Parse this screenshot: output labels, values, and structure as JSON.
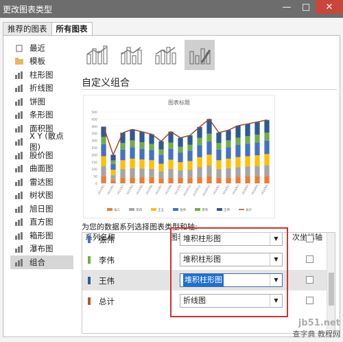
{
  "window": {
    "title": "更改图表类型",
    "minimize": "—",
    "maximize": "□",
    "close": "✕"
  },
  "tabs": [
    "推荐的图表",
    "所有图表"
  ],
  "sidebar": {
    "items": [
      {
        "label": "最近",
        "icon": "recent-icon"
      },
      {
        "label": "模板",
        "icon": "folder-icon"
      },
      {
        "label": "柱形图",
        "icon": "column-chart-icon"
      },
      {
        "label": "折线图",
        "icon": "line-chart-icon"
      },
      {
        "label": "饼图",
        "icon": "pie-chart-icon"
      },
      {
        "label": "条形图",
        "icon": "bar-chart-icon"
      },
      {
        "label": "面积图",
        "icon": "area-chart-icon"
      },
      {
        "label": "X Y (散点图)",
        "icon": "scatter-chart-icon"
      },
      {
        "label": "股价图",
        "icon": "stock-chart-icon"
      },
      {
        "label": "曲面图",
        "icon": "surface-chart-icon"
      },
      {
        "label": "雷达图",
        "icon": "radar-chart-icon"
      },
      {
        "label": "树状图",
        "icon": "treemap-icon"
      },
      {
        "label": "旭日图",
        "icon": "sunburst-icon"
      },
      {
        "label": "直方图",
        "icon": "histogram-icon"
      },
      {
        "label": "箱形图",
        "icon": "box-whisker-icon"
      },
      {
        "label": "瀑布图",
        "icon": "waterfall-icon"
      },
      {
        "label": "组合",
        "icon": "combo-chart-icon"
      }
    ],
    "selected_index": 16
  },
  "combo_types": [
    "clustered-column-line-icon",
    "clustered-column-line-secondary-icon",
    "stacked-area-column-icon",
    "custom-combo-icon"
  ],
  "section_title": "自定义组合",
  "chart_data": {
    "type": "bar",
    "title": "图表标题",
    "categories": [
      "2015年1",
      "2015年2",
      "2015年3",
      "2015年4",
      "2015年5",
      "2015年6",
      "2015年7",
      "2015年8",
      "2015年9",
      "2015年10",
      "2015年11",
      "2015年12",
      "2016年1",
      "2016年2",
      "2016年3",
      "2016年4",
      "2016年5",
      "2016年6"
    ],
    "ylim": [
      0,
      500
    ],
    "yticks": [
      "0",
      "50",
      "100",
      "150",
      "200",
      "250",
      "300",
      "350",
      "400",
      "450",
      "500"
    ],
    "stacked": true,
    "series": [
      {
        "name": "张三",
        "color": "#ed7d31",
        "values": [
          50,
          22,
          40,
          42,
          45,
          44,
          35,
          40,
          38,
          38,
          45,
          50,
          40,
          42,
          46,
          48,
          50,
          52
        ]
      },
      {
        "name": "李四",
        "color": "#a5a5a5",
        "values": [
          70,
          35,
          60,
          65,
          60,
          58,
          50,
          62,
          55,
          58,
          68,
          75,
          60,
          65,
          68,
          70,
          72,
          75
        ]
      },
      {
        "name": "王五",
        "color": "#ffc000",
        "values": [
          70,
          38,
          62,
          66,
          62,
          60,
          52,
          64,
          55,
          60,
          70,
          76,
          62,
          66,
          70,
          72,
          75,
          78
        ]
      },
      {
        "name": "张伟",
        "color": "#4472c4",
        "values": [
          85,
          40,
          75,
          80,
          75,
          72,
          62,
          76,
          68,
          72,
          85,
          92,
          75,
          80,
          85,
          88,
          90,
          94
        ]
      },
      {
        "name": "李伟",
        "color": "#70ad47",
        "values": [
          50,
          25,
          45,
          48,
          45,
          42,
          38,
          44,
          40,
          42,
          50,
          55,
          45,
          48,
          50,
          52,
          54,
          56
        ]
      },
      {
        "name": "王伟",
        "color": "#2e5a94",
        "values": [
          72,
          40,
          72,
          77,
          74,
          68,
          58,
          76,
          63,
          66,
          77,
          102,
          73,
          72,
          85,
          86,
          89,
          89
        ]
      }
    ],
    "line": {
      "name": "总计",
      "color": "#9e4a2a",
      "values": [
        397,
        200,
        354,
        378,
        361,
        344,
        295,
        362,
        319,
        336,
        395,
        450,
        355,
        373,
        404,
        416,
        430,
        444
      ]
    }
  },
  "choose_label": "为您的数据系列选择图表类型和轴:",
  "table": {
    "headers": {
      "name": "系列名称",
      "type": "图表类型",
      "axis": "次坐标轴"
    },
    "rows": [
      {
        "name": "张伟",
        "type": "堆积柱形图",
        "color": "#4472c4"
      },
      {
        "name": "李伟",
        "type": "堆积柱形图",
        "color": "#70ad47"
      },
      {
        "name": "王伟",
        "type": "堆积柱形图",
        "color": "#2e5a94"
      },
      {
        "name": "总计",
        "type": "折线图",
        "color": "#b05a2c"
      }
    ],
    "selected_row": 2
  },
  "watermark": {
    "line1": "jb51.net",
    "line2": "查字典 教程网"
  }
}
